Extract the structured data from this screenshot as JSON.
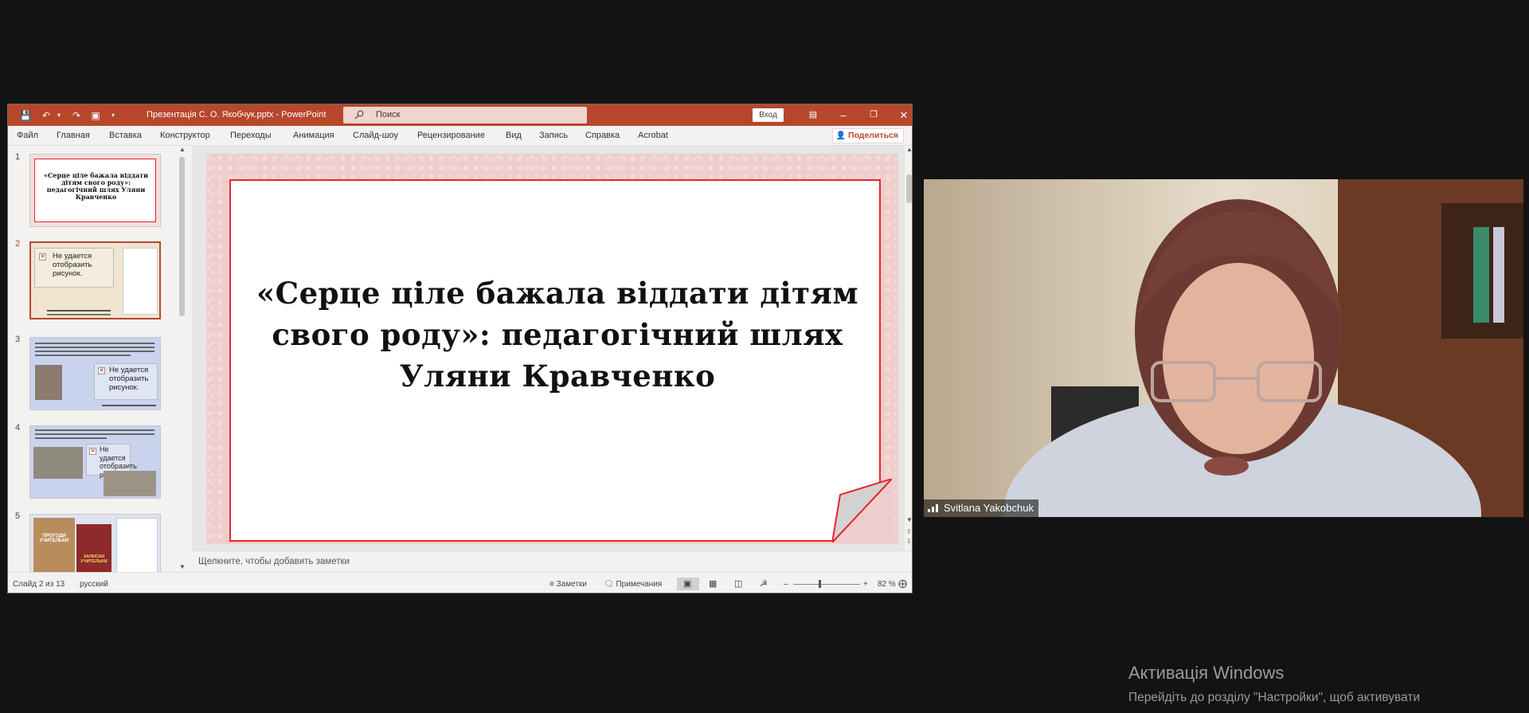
{
  "window": {
    "title": "Презентація С. О. Якобчук.pptx  -  PowerPoint",
    "search_placeholder": "Поиск",
    "signin_label": "Вход",
    "share_label": "Поделиться"
  },
  "ribbon": {
    "tabs": [
      "Файл",
      "Главная",
      "Вставка",
      "Конструктор",
      "Переходы",
      "Анимация",
      "Слайд-шоу",
      "Рецензирование",
      "Вид",
      "Запись",
      "Справка",
      "Acrobat"
    ]
  },
  "thumbnails": [
    {
      "number": "1",
      "title": "«Серце ціле бажала віддати дітям свого роду»: педагогічний шлях Уляни Кравченко"
    },
    {
      "number": "2",
      "placeholder": "Не удается отобразить рисунок."
    },
    {
      "number": "3",
      "placeholder": "Не удается отобразить рисунок."
    },
    {
      "number": "4",
      "placeholder": "Не удается отобразить рисунок."
    },
    {
      "number": "5",
      "book_left": "ПРОГОДИ УЧИТЕЛЬКИ",
      "book_right": "ЗАПИСКИ УЧИТЕЛЬКИ"
    }
  ],
  "slide": {
    "title": "«Серце ціле бажала віддати дітям свого роду»: педагогічний шлях Уляни Кравченко"
  },
  "notes": {
    "placeholder": "Щелкните, чтобы добавить заметки"
  },
  "status": {
    "slide_counter": "Слайд 2 из 13",
    "language": "русский",
    "notes_label": "Заметки",
    "comments_label": "Примечания",
    "zoom": "82 %"
  },
  "video": {
    "participant_name": "Svitlana Yakobchuk"
  },
  "watermark": {
    "title": "Активація Windows",
    "subtitle": "Перейдіть до розділу \"Настройки\", щоб активувати"
  },
  "colors": {
    "accent": "#b7472a",
    "slide_border": "#e8222a",
    "slide_background": "#f0cdcd"
  }
}
